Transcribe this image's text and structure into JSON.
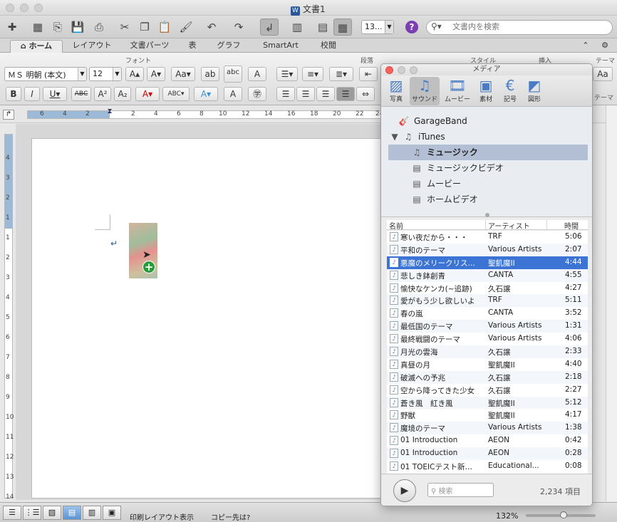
{
  "window": {
    "title": "文書1"
  },
  "toolbar": {
    "zoom_value": "13...",
    "search_placeholder": "文書内を検索"
  },
  "ribbon_tabs": [
    "ホーム",
    "レイアウト",
    "文書パーツ",
    "表",
    "グラフ",
    "SmartArt",
    "校閲"
  ],
  "ribbon": {
    "group_font": "フォント",
    "group_paragraph": "段落",
    "group_style": "スタイル",
    "group_insert": "挿入",
    "group_theme": "テーマ",
    "font_name": "ＭＳ 明朝 (本文)",
    "font_size": "12",
    "theme_label": "テーマ"
  },
  "ruler_numbers": [
    "6",
    "4",
    "2",
    "2",
    "4",
    "6",
    "8",
    "10",
    "12",
    "14",
    "16",
    "18",
    "20",
    "22",
    "24"
  ],
  "vruler_numbers": [
    "4",
    "3",
    "2",
    "1",
    "1",
    "2",
    "3",
    "4",
    "5",
    "6",
    "7",
    "8",
    "9",
    "10",
    "11",
    "12",
    "13",
    "14"
  ],
  "status": {
    "view": "印刷レイアウト表示",
    "copy": "コピー先は?",
    "zoom": "132%"
  },
  "media": {
    "title": "メディア",
    "tabs": [
      "写真",
      "サウンド",
      "ムービー",
      "素材",
      "記号",
      "図形"
    ],
    "tree": [
      {
        "label": "GarageBand"
      },
      {
        "label": "iTunes"
      },
      {
        "label": "ミュージック"
      },
      {
        "label": "ミュージックビデオ"
      },
      {
        "label": "ムービー"
      },
      {
        "label": "ホームビデオ"
      }
    ],
    "columns": {
      "name": "名前",
      "artist": "アーティスト",
      "time": "時間"
    },
    "rows": [
      {
        "name": "寒い夜だから・・・",
        "artist": "TRF",
        "time": "5:06"
      },
      {
        "name": "平和のテーマ",
        "artist": "Various Artists",
        "time": "2:07"
      },
      {
        "name": "悪魔のメリークリス…",
        "artist": "聖飢魔II",
        "time": "4:44"
      },
      {
        "name": "悲しき鉢創青",
        "artist": "CANTA",
        "time": "4:55"
      },
      {
        "name": "愉快なケンカ(~追跡)",
        "artist": "久石譲",
        "time": "4:27"
      },
      {
        "name": "愛がもう少し欲しいよ",
        "artist": "TRF",
        "time": "5:11"
      },
      {
        "name": "春の嵐",
        "artist": "CANTA",
        "time": "3:52"
      },
      {
        "name": "最低国のテーマ",
        "artist": "Various Artists",
        "time": "1:31"
      },
      {
        "name": "最終戦闘のテーマ",
        "artist": "Various Artists",
        "time": "4:06"
      },
      {
        "name": "月光の雲海",
        "artist": "久石譲",
        "time": "2:33"
      },
      {
        "name": "真昼の月",
        "artist": "聖飢魔II",
        "time": "4:40"
      },
      {
        "name": "破滅への予兆",
        "artist": "久石譲",
        "time": "2:18"
      },
      {
        "name": "空から降ってきた少女",
        "artist": "久石譲",
        "time": "2:27"
      },
      {
        "name": "蒼き風　紅き風",
        "artist": "聖飢魔II",
        "time": "5:12"
      },
      {
        "name": "野獣",
        "artist": "聖飢魔II",
        "time": "4:17"
      },
      {
        "name": "魔境のテーマ",
        "artist": "Various Artists",
        "time": "1:38"
      },
      {
        "name": "01 Introduction",
        "artist": "AEON",
        "time": "0:42"
      },
      {
        "name": "01 Introduction",
        "artist": "AEON",
        "time": "0:28"
      },
      {
        "name": "01 TOEICテスト新…",
        "artist": "Educational...",
        "time": "0:08"
      }
    ],
    "selected_row": 2,
    "search_placeholder": "検索",
    "count": "2,234 項目"
  }
}
